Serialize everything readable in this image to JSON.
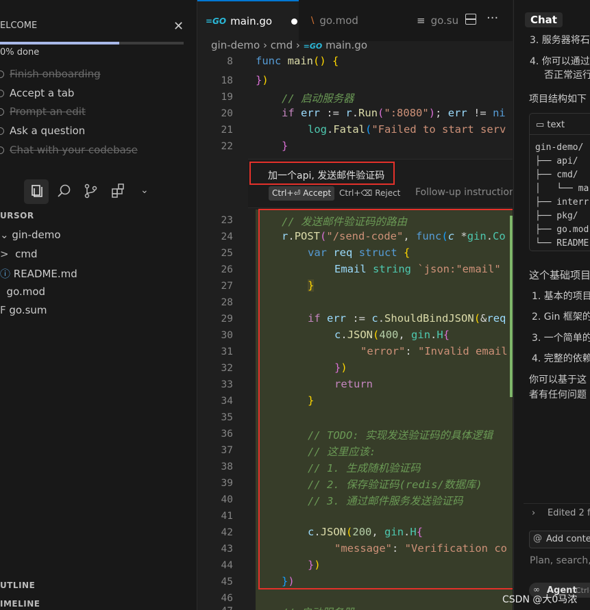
{
  "sidebar": {
    "welcome_title": "ELCOME",
    "progress": "0% done",
    "progress_fraction": 0.65,
    "onboarding": [
      {
        "label": "Finish onboarding",
        "done": true
      },
      {
        "label": "Accept a tab",
        "done": false
      },
      {
        "label": "Prompt an edit",
        "done": true
      },
      {
        "label": "Ask a question",
        "done": false
      },
      {
        "label": "Chat with your codebase",
        "done": true
      }
    ],
    "explorer_section": "URSOR",
    "tree": {
      "root": "gin-demo",
      "cmd": "cmd",
      "readme": "README.md",
      "gomod": "go.mod",
      "gosum": "go.sum"
    },
    "outline": "UTLINE",
    "timeline": "IMELINE"
  },
  "editor": {
    "tabs": {
      "main": "main.go",
      "mod": "go.mod",
      "sum": "go.su"
    },
    "breadcrumb": [
      "gin-demo",
      "cmd",
      "main.go"
    ],
    "sticky_line": "8",
    "lines_top": [
      "18",
      "19",
      "20",
      "21",
      "22"
    ],
    "comment_server": "// 启动服务器",
    "run_code": ":8080",
    "fatal_msg": "\"Failed to start serv",
    "prompt": {
      "text": "加一个api, 发送邮件验证码",
      "accept": "Ctrl+⏎ Accept",
      "reject": "Ctrl+⌫ Reject",
      "followup": "Follow-up instructions"
    },
    "lines": [
      "23",
      "24",
      "25",
      "26",
      "27",
      "28",
      "29",
      "30",
      "31",
      "32",
      "33",
      "34",
      "35",
      "36",
      "37",
      "38",
      "39",
      "40",
      "41",
      "42",
      "43",
      "44",
      "45",
      "46",
      "47"
    ],
    "c23": "// 发送邮件验证码的路由",
    "c24_route": "\"/send-code\"",
    "c26_tag": "`json:\"email\"",
    "c31_err": "\"error\"",
    "c31_msg": "\"Invalid email",
    "c36": "// TODO: 实现发送验证码的具体逻辑",
    "c37": "// 这里应该:",
    "c38": "// 1. 生成随机验证码",
    "c39": "// 2. 保存验证码(redis/数据库)",
    "c40": "// 3. 通过邮件服务发送验证码",
    "c43_key": "\"message\"",
    "c43_val": "\"Verification co",
    "c47": "// 启动服务器",
    "n400": "400",
    "n200": "200"
  },
  "chat": {
    "title": "Chat",
    "item3": "3. 服务器将石",
    "item4a": "4. 你可以通过",
    "item4b": "否正常运行",
    "structure": "项目结构如下",
    "code_label": "text",
    "tree": [
      "gin-demo/",
      "├── api/",
      "├── cmd/",
      "│   └── ma",
      "├── interr",
      "├── pkg/",
      "├── go.mod",
      "└── README"
    ],
    "summary": "这个基础项目",
    "points": [
      "1. 基本的项目",
      "2. Gin 框架的",
      "3. 一个简单的",
      "4. 完整的依赖"
    ],
    "outro1": "你可以基于这",
    "outro2": "者有任何问题",
    "edited": "Edited 2 fi",
    "add_context": "Add contex",
    "input_placeholder": "Plan, search,",
    "agent": "Agent",
    "agent_shortcut": "Ctrl+"
  },
  "watermark": "CSDN @大0马浓",
  "colors": {
    "annotation_red": "#e5312a",
    "diff_bg": "#373d29",
    "accent_blue": "#0078d4"
  }
}
